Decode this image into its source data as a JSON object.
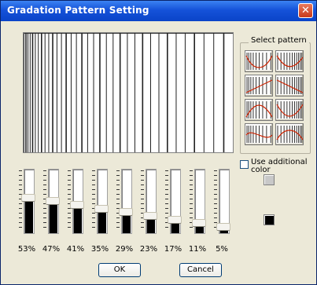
{
  "window": {
    "title": "Gradation Pattern Setting",
    "close_glyph": "✕"
  },
  "select_pattern": {
    "label": "Select pattern",
    "patterns": [
      "pattern-1",
      "pattern-2",
      "pattern-3",
      "pattern-4",
      "pattern-5",
      "pattern-6",
      "pattern-7",
      "pattern-8"
    ]
  },
  "use_additional_color": {
    "label": "Use additional color",
    "checked": false
  },
  "color_swatches": [
    {
      "name": "additional-color",
      "color": "#c8c8c8"
    },
    {
      "name": "main-color",
      "color": "#000000"
    }
  ],
  "sliders": [
    {
      "label": "53%",
      "value": 0.53
    },
    {
      "label": "47%",
      "value": 0.47
    },
    {
      "label": "41%",
      "value": 0.41
    },
    {
      "label": "35%",
      "value": 0.35
    },
    {
      "label": "29%",
      "value": 0.29
    },
    {
      "label": "23%",
      "value": 0.23
    },
    {
      "label": "17%",
      "value": 0.17
    },
    {
      "label": "11%",
      "value": 0.11
    },
    {
      "label": "5%",
      "value": 0.05
    }
  ],
  "buttons": {
    "ok": "OK",
    "cancel": "Cancel"
  },
  "colors": {
    "title_bar": "#0a44c8",
    "dialog_bg": "#ece9d8",
    "close_button": "#c8391b",
    "pattern_accent": "#cc2200"
  }
}
